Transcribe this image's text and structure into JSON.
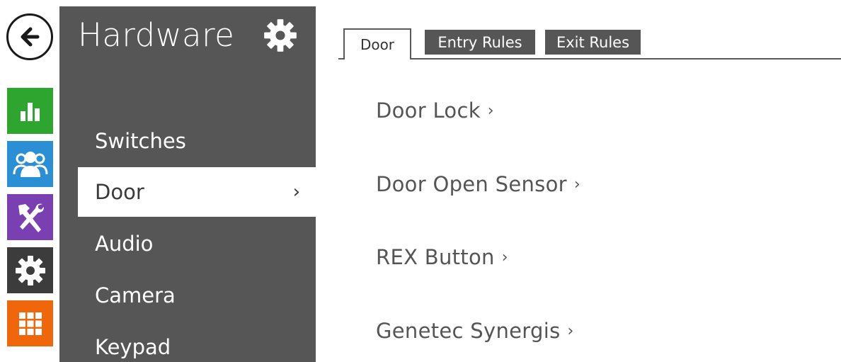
{
  "rail": {
    "back_icon": "back-arrow-icon",
    "items": [
      {
        "name": "status",
        "icon": "bar-chart-icon",
        "color": "#2ea52f"
      },
      {
        "name": "directory",
        "icon": "users-icon",
        "color": "#2b8fd6"
      },
      {
        "name": "services",
        "icon": "tools-icon",
        "color": "#7a3fb0"
      },
      {
        "name": "hardware",
        "icon": "gear-icon",
        "color": "#3c3c3c"
      },
      {
        "name": "system",
        "icon": "grid-icon",
        "color": "#f0660a"
      }
    ]
  },
  "nav": {
    "title": "Hardware",
    "title_icon": "gear-icon",
    "items": [
      {
        "label": "Switches"
      },
      {
        "label": "Door",
        "chevron": "›",
        "active": true
      },
      {
        "label": "Audio"
      },
      {
        "label": "Camera"
      },
      {
        "label": "Keypad"
      }
    ]
  },
  "tabs": [
    {
      "label": "Door",
      "active": true
    },
    {
      "label": "Entry Rules"
    },
    {
      "label": "Exit Rules"
    }
  ],
  "content": {
    "links": [
      {
        "label": "Door Lock",
        "chevron": "›"
      },
      {
        "label": "Door Open Sensor",
        "chevron": "›"
      },
      {
        "label": "REX Button",
        "chevron": "›"
      },
      {
        "label": "Genetec Synergis",
        "chevron": "›"
      }
    ]
  },
  "colors": {
    "nav_bg": "#565656",
    "tab_inactive_bg": "#565656",
    "text_muted": "#555555"
  }
}
